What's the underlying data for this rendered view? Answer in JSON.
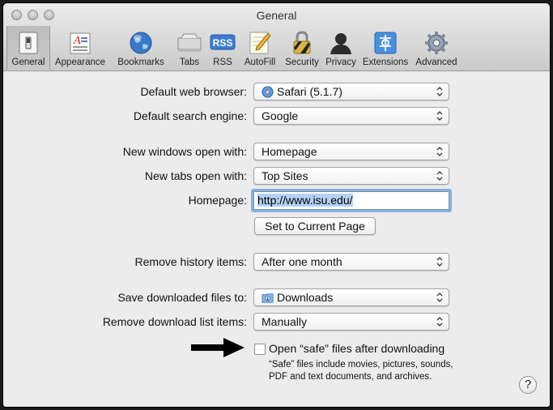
{
  "window": {
    "title": "General"
  },
  "toolbar": {
    "items": [
      {
        "label": "General",
        "icon": "general-switch-icon",
        "selected": true
      },
      {
        "label": "Appearance",
        "icon": "appearance-icon"
      },
      {
        "label": "Bookmarks",
        "icon": "bookmarks-globe-icon"
      },
      {
        "label": "Tabs",
        "icon": "tabs-icon"
      },
      {
        "label": "RSS",
        "icon": "rss-icon"
      },
      {
        "label": "AutoFill",
        "icon": "autofill-pencil-icon"
      },
      {
        "label": "Security",
        "icon": "security-lock-icon"
      },
      {
        "label": "Privacy",
        "icon": "privacy-person-icon"
      },
      {
        "label": "Extensions",
        "icon": "extensions-icon"
      },
      {
        "label": "Advanced",
        "icon": "advanced-gear-icon"
      }
    ],
    "rss_icon_text": "RSS"
  },
  "settings": {
    "default_browser": {
      "label": "Default web browser:",
      "value": "Safari (5.1.7)"
    },
    "search_engine": {
      "label": "Default search engine:",
      "value": "Google"
    },
    "new_windows": {
      "label": "New windows open with:",
      "value": "Homepage"
    },
    "new_tabs": {
      "label": "New tabs open with:",
      "value": "Top Sites"
    },
    "homepage": {
      "label": "Homepage:",
      "value": "http://www.isu.edu/"
    },
    "set_current_page": "Set to Current Page",
    "remove_history": {
      "label": "Remove history items:",
      "value": "After one month"
    },
    "save_downloads": {
      "label": "Save downloaded files to:",
      "value": "Downloads"
    },
    "remove_download_list": {
      "label": "Remove download list items:",
      "value": "Manually"
    },
    "open_safe_files": {
      "label": "Open “safe” files after downloading",
      "checked": false,
      "help_line1": "“Safe” files include movies, pictures, sounds,",
      "help_line2": "PDF and text documents, and archives."
    },
    "help_button": "?"
  }
}
